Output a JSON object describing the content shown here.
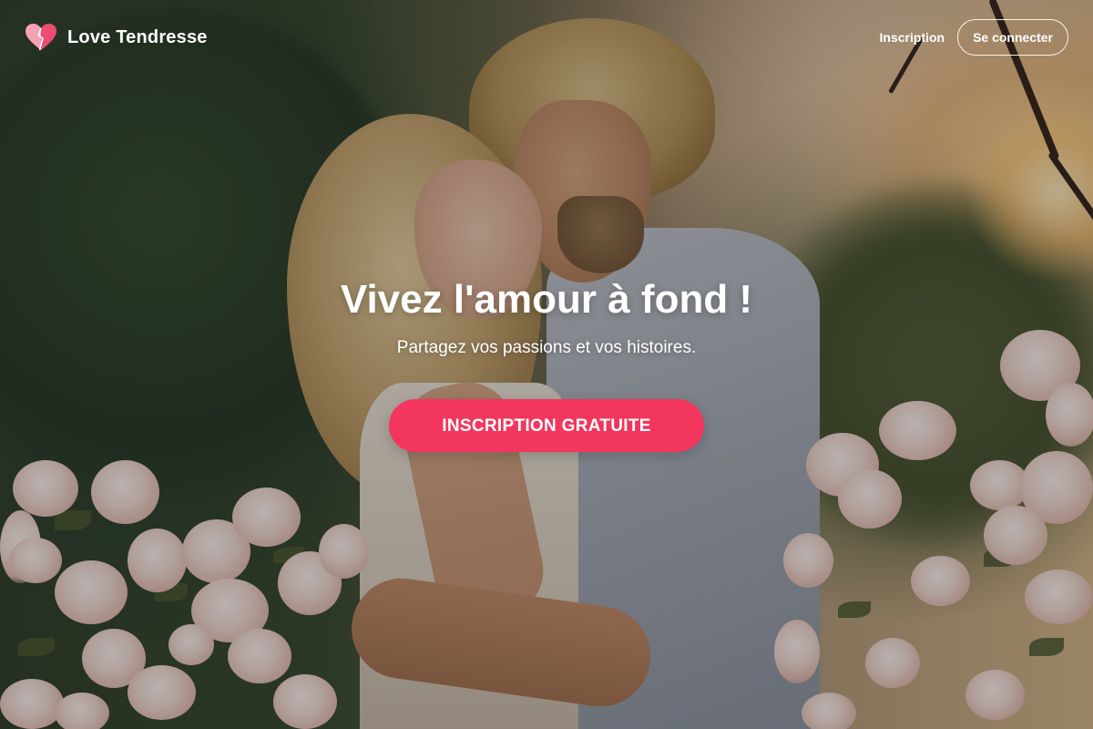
{
  "brand": {
    "name": "Love Tendresse",
    "logo_icon": "heart-icon",
    "logo_colors": [
      "#f6a2b6",
      "#ec4c73"
    ]
  },
  "nav": {
    "signup_link": "Inscription",
    "login_button": "Se connecter"
  },
  "hero": {
    "title": "Vivez l'amour à fond !",
    "subtitle": "Partagez vos passions et vos histoires.",
    "cta_label": "INSCRIPTION GRATUITE",
    "background_image": "couple-embracing-in-rose-garden-at-sunset"
  },
  "colors": {
    "accent": "#f2365d",
    "text": "#ffffff"
  }
}
